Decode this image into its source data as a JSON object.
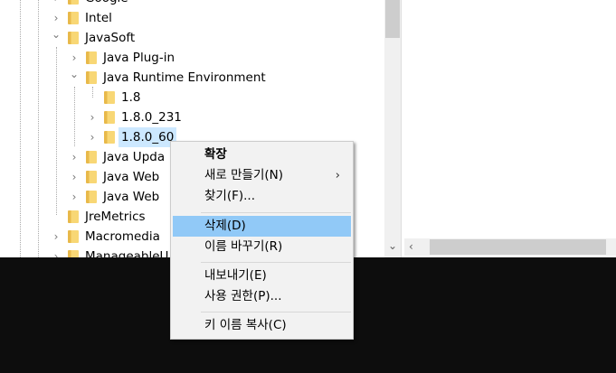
{
  "tree": [
    {
      "label": "Google",
      "level": 0,
      "expander": "collapsed"
    },
    {
      "label": "Intel",
      "level": 0,
      "expander": "collapsed"
    },
    {
      "label": "JavaSoft",
      "level": 0,
      "expander": "expanded"
    },
    {
      "label": "Java Plug-in",
      "level": 1,
      "expander": "collapsed"
    },
    {
      "label": "Java Runtime Environment",
      "level": 1,
      "expander": "expanded"
    },
    {
      "label": "1.8",
      "level": 2,
      "expander": "none"
    },
    {
      "label": "1.8.0_231",
      "level": 2,
      "expander": "collapsed"
    },
    {
      "label": "1.8.0_60",
      "level": 2,
      "expander": "collapsed",
      "selected": true
    },
    {
      "label": "Java Upda",
      "level": 1,
      "expander": "collapsed"
    },
    {
      "label": "Java Web",
      "level": 1,
      "expander": "collapsed"
    },
    {
      "label": "Java Web",
      "level": 1,
      "expander": "collapsed"
    },
    {
      "label": "JreMetrics",
      "level": 0,
      "expander": "none"
    },
    {
      "label": "Macromedia",
      "level": 0,
      "expander": "collapsed"
    },
    {
      "label": "ManageableU",
      "level": 0,
      "expander": "collapsed"
    }
  ],
  "menu": {
    "expand": "확장",
    "new": "새로 만들기(N)",
    "find": "찾기(F)...",
    "delete": "삭제(D)",
    "rename": "이름 바꾸기(R)",
    "export": "내보내기(E)",
    "permissions": "사용 권한(P)...",
    "copy_key_name": "키 이름 복사(C)",
    "submenu_arrow": "›"
  },
  "scroll": {
    "down_arrow": "⌄",
    "left_arrow": "‹"
  }
}
